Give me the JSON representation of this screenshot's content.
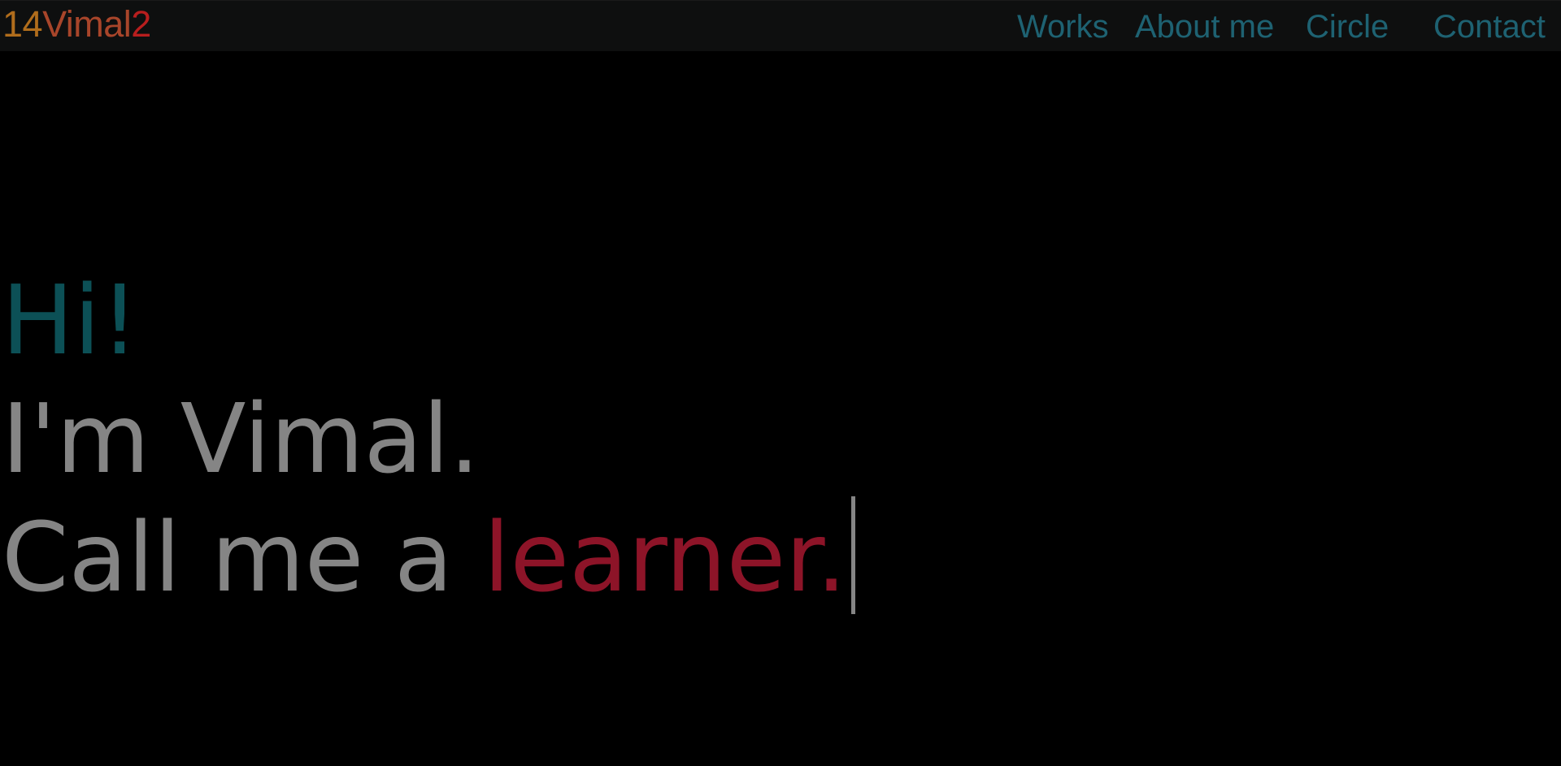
{
  "colors": {
    "background": "#000000",
    "navbar_bg": "#0e0f0f",
    "brand_digits": "#b06d1c",
    "brand_name": "#a8452a",
    "brand_suffix": "#b81e1e",
    "nav_link": "#1e6272",
    "hi": "#0c5056",
    "hero_text": "#858585",
    "highlight": "#8d1428",
    "cursor": "#858585"
  },
  "brand": {
    "prefix": "14",
    "name": "Vimal",
    "suffix": "2"
  },
  "nav": {
    "items": [
      {
        "label": "Works"
      },
      {
        "label": "About me"
      },
      {
        "label": "Circle"
      },
      {
        "label": "Contact"
      }
    ]
  },
  "hero": {
    "greeting": "Hi!",
    "intro": "I'm Vimal.",
    "tagline_prefix": "Call me a ",
    "tagline_word": "learner."
  }
}
